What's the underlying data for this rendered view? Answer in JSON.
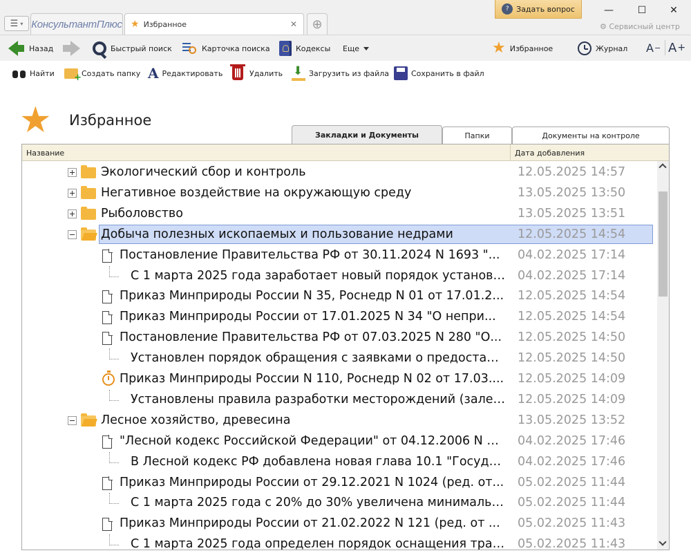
{
  "titlebar": {
    "brand": "КонсультантПлюс",
    "active_tab": "Избранное",
    "ask_button": "Задать вопрос",
    "service_center": "Сервисный центр",
    "window_controls": {
      "minimize": "—",
      "maximize": "☐",
      "close": "✕"
    }
  },
  "toolbar": {
    "back": "Назад",
    "quick_search": "Быстрый поиск",
    "search_card": "Карточка поиска",
    "codes": "Кодексы",
    "more": "Еще",
    "favorites": "Избранное",
    "journal": "Журнал",
    "font_decrease": "A",
    "font_increase": "A"
  },
  "actions": {
    "find": "Найти",
    "create_folder": "Создать папку",
    "edit": "Редактировать",
    "delete": "Удалить",
    "load_file": "Загрузить из файла",
    "save_file": "Сохранить в файл"
  },
  "page": {
    "title": "Избранное",
    "tabs": [
      "Закладки и Документы",
      "Папки",
      "Документы на контроле"
    ],
    "active_tab_index": 0
  },
  "grid": {
    "columns": {
      "name": "Название",
      "date": "Дата добавления"
    },
    "rows": [
      {
        "type": "folder",
        "state": "collapsed",
        "level": 0,
        "text": "Экологический сбор и контроль",
        "date": "12.05.2025 14:57"
      },
      {
        "type": "folder",
        "state": "collapsed",
        "level": 0,
        "text": "Негативное воздействие на окружающую среду",
        "date": "13.05.2025 13:50"
      },
      {
        "type": "folder",
        "state": "collapsed",
        "level": 0,
        "text": "Рыболовство",
        "date": "13.05.2025 13:51"
      },
      {
        "type": "folder",
        "state": "expanded",
        "level": 0,
        "selected": true,
        "text": "Добыча полезных ископаемых и пользование недрами",
        "date": "12.05.2025 14:54"
      },
      {
        "type": "doc",
        "level": 1,
        "text": "Постановление Правительства РФ от 30.11.2024 N 1693 \"...",
        "date": "04.02.2025 17:14"
      },
      {
        "type": "note",
        "level": 2,
        "text": "С 1 марта 2025 года заработает новый порядок установле...",
        "date": "04.02.2025 17:14"
      },
      {
        "type": "doc",
        "level": 1,
        "text": "Приказ Минприроды России N 35, Роснедр N 01 от 17.01.2...",
        "date": "12.05.2025 14:54"
      },
      {
        "type": "doc",
        "level": 1,
        "text": "Приказ Минприроды России от 17.01.2025 N 34 \"О непри...",
        "date": "12.05.2025 14:54"
      },
      {
        "type": "doc",
        "level": 1,
        "text": "Постановление Правительства РФ от 07.03.2025 N 280 \"О...",
        "date": "12.05.2025 14:50"
      },
      {
        "type": "note",
        "level": 2,
        "text": "Установлен порядок обращения с заявками о предоставле...",
        "date": "12.05.2025 14:50"
      },
      {
        "type": "timer",
        "level": 1,
        "text": "Приказ Минприроды России N 110, Роснедр N 02 от 17.03....",
        "date": "12.05.2025 14:09"
      },
      {
        "type": "note",
        "level": 2,
        "text": "Установлены правила разработки месторождений (залеж...",
        "date": "12.05.2025 14:09"
      },
      {
        "type": "folder",
        "state": "expanded",
        "level": 0,
        "text": "Лесное хозяйство, древесина",
        "date": "13.05.2025 13:52"
      },
      {
        "type": "doc",
        "level": 1,
        "text": "\"Лесной кодекс Российской Федерации\" от 04.12.2006 N 2...",
        "date": "04.02.2025 17:46"
      },
      {
        "type": "note",
        "level": 2,
        "text": "В Лесной кодекс РФ добавлена новая глава 10.1 \"Государс...",
        "date": "04.02.2025 17:46"
      },
      {
        "type": "doc",
        "level": 1,
        "text": "Приказ Минприроды России от 29.12.2021 N 1024 (ред. от...",
        "date": "05.02.2025 11:44"
      },
      {
        "type": "note",
        "level": 2,
        "text": "С 1 марта 2025 года с 20% до 30% увеличена минимальна...",
        "date": "05.02.2025 11:44"
      },
      {
        "type": "doc",
        "level": 1,
        "text": "Приказ Минприроды России от 21.02.2022 N 121 (ред. от ...",
        "date": "05.02.2025 11:43"
      },
      {
        "type": "note",
        "level": 2,
        "text": "С 1 марта 2025 года определен порядок оснащения транс...",
        "date": "05.02.2025 11:43"
      }
    ]
  },
  "colors": {
    "accent_star": "#f0a030",
    "selection": "#cfdcf7",
    "date_text": "#9a9a9a",
    "back_arrow": "#3a8d2a"
  }
}
